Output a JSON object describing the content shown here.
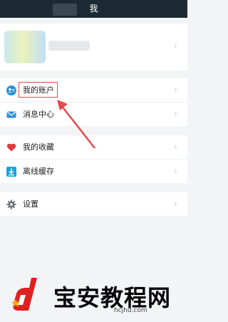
{
  "header": {
    "title": "我"
  },
  "menu": {
    "group1": [
      {
        "label": "我的账户",
        "icon": "account-icon"
      },
      {
        "label": "消息中心",
        "icon": "mail-icon"
      }
    ],
    "group2": [
      {
        "label": "我的收藏",
        "icon": "heart-icon"
      },
      {
        "label": "离线缓存",
        "icon": "download-icon"
      }
    ],
    "group3": [
      {
        "label": "设置",
        "icon": "gear-icon"
      }
    ]
  },
  "watermark": {
    "text": "宝安教程网",
    "url": "hcjhd.com"
  },
  "colors": {
    "topbar": "#1c2a33",
    "highlight": "#e8484c",
    "account": "#2f8fd8",
    "heart": "#e23a3e",
    "download": "#1fa3d8"
  }
}
